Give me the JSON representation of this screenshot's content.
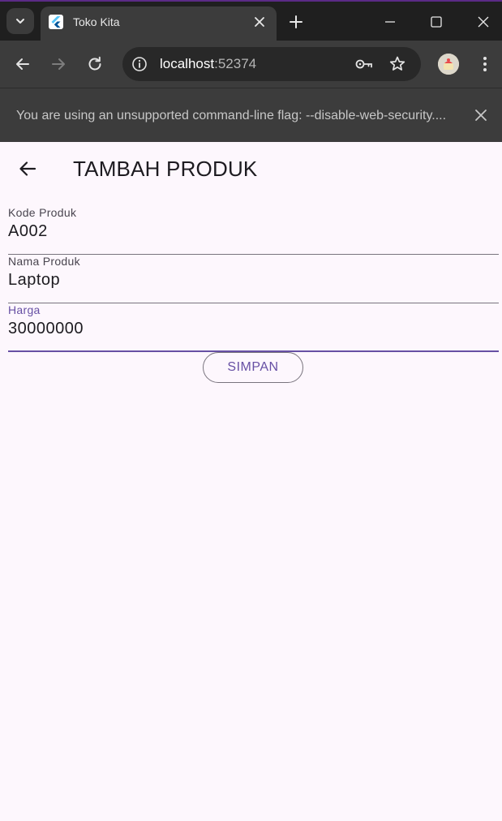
{
  "browser": {
    "tab_title": "Toko Kita",
    "url_host": "localhost",
    "url_port": ":52374",
    "infobar_message": "You are using an unsupported command-line flag: --disable-web-security...."
  },
  "app": {
    "title": "TAMBAH PRODUK",
    "fields": [
      {
        "label": "Kode Produk",
        "value": "A002"
      },
      {
        "label": "Nama Produk",
        "value": "Laptop"
      },
      {
        "label": "Harga",
        "value": "30000000"
      }
    ],
    "save_label": "SIMPAN"
  },
  "colors": {
    "accent": "#6750a4",
    "background": "#fdf7fd",
    "chrome_dark": "#1f1f1f",
    "chrome_toolbar": "#3c3c3c"
  }
}
